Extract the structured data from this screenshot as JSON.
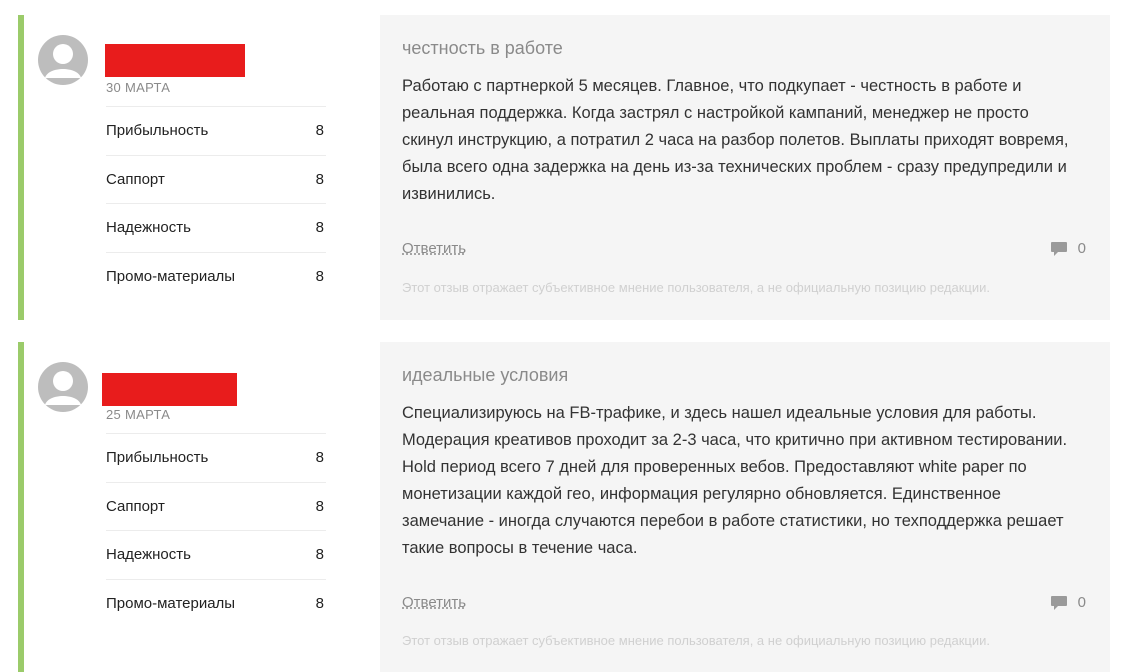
{
  "reviews": [
    {
      "author_redacted": true,
      "date": "30 МАРТА",
      "ratings": [
        {
          "label": "Прибыльность",
          "value": "8"
        },
        {
          "label": "Саппорт",
          "value": "8"
        },
        {
          "label": "Надежность",
          "value": "8"
        },
        {
          "label": "Промо-материалы",
          "value": "8"
        }
      ],
      "title": "честность в работе",
      "text": "Работаю с партнеркой 5 месяцев. Главное, что подкупает - честность в работе и реальная поддержка. Когда застрял с настройкой кампаний, менеджер не просто скинул инструкцию, а потратил 2 часа на разбор полетов. Выплаты приходят вовремя, была всего одна задержка на день из-за технических проблем - сразу предупредили и извинились.",
      "reply_label": "Ответить",
      "comment_count": "0",
      "disclaimer": "Этот отзыв отражает субъективное мнение пользователя, а не официальную позицию редакции."
    },
    {
      "author_redacted": true,
      "date": "25 МАРТА",
      "ratings": [
        {
          "label": "Прибыльность",
          "value": "8"
        },
        {
          "label": "Саппорт",
          "value": "8"
        },
        {
          "label": "Надежность",
          "value": "8"
        },
        {
          "label": "Промо-материалы",
          "value": "8"
        }
      ],
      "title": "идеальные условия",
      "text": "Специализируюсь на FB-трафике, и здесь нашел идеальные условия для работы. Модерация креативов проходит за 2-3 часа, что критично при активном тестировании. Hold период всего 7 дней для проверенных вебов. Предоставляют white paper по монетизации каждой гео, информация регулярно обновляется. Единственное замечание - иногда случаются перебои в работе статистики, но техподдержка решает такие вопросы в течение часа.",
      "reply_label": "Ответить",
      "comment_count": "0",
      "disclaimer": "Этот отзыв отражает субъективное мнение пользователя, а не официальную позицию редакции."
    }
  ],
  "colors": {
    "accent_border": "#9bcb6a",
    "redaction": "#e81c1c",
    "panel_bg": "#f5f5f5"
  },
  "icons": {
    "avatar": "user-avatar-icon",
    "comments": "comment-bubble-icon"
  }
}
